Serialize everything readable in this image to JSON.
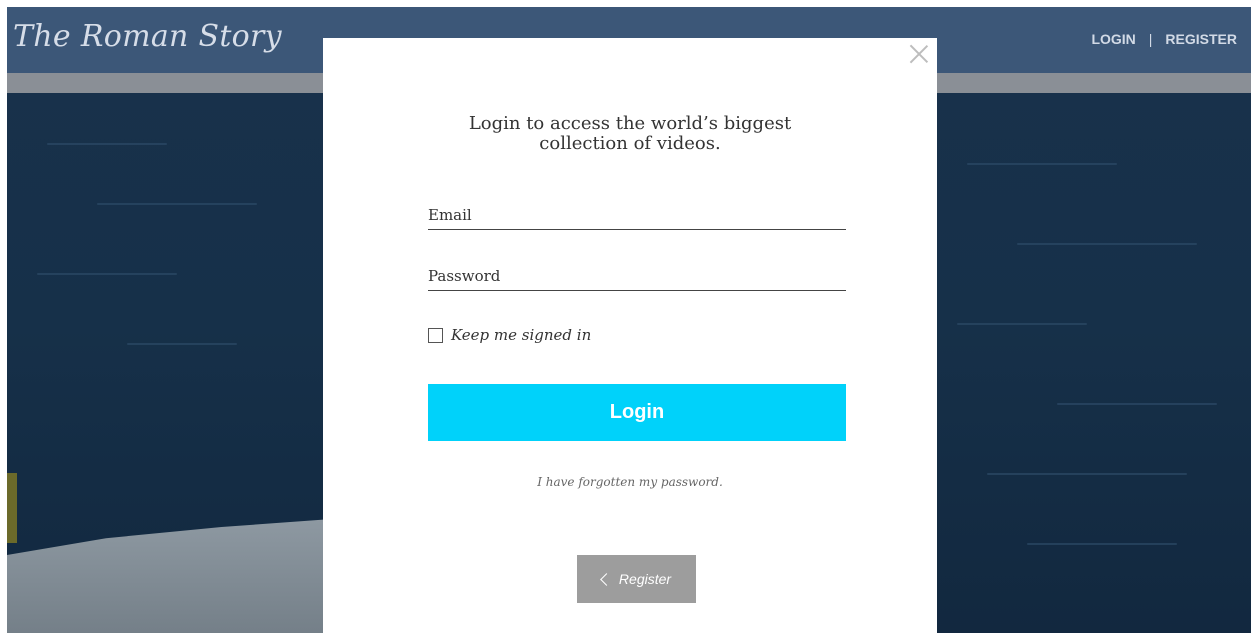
{
  "header": {
    "logo": "The Roman Story",
    "login_label": "LOGIN",
    "separator": "|",
    "register_label": "REGISTER"
  },
  "modal": {
    "close_icon": "close-icon",
    "title_line1": "Login to access the world’s biggest",
    "title_line2": "collection of videos.",
    "email_placeholder": "Email",
    "password_placeholder": "Password",
    "remember_label": "Keep me signed in",
    "login_button": "Login",
    "forgot_link": "I have forgotten my password.",
    "register_button": "Register",
    "register_icon": "chevron-left-icon"
  },
  "colors": {
    "header_bg": "#3c5778",
    "login_button_bg": "#00d2fa",
    "register_button_bg": "#9d9d9d"
  }
}
